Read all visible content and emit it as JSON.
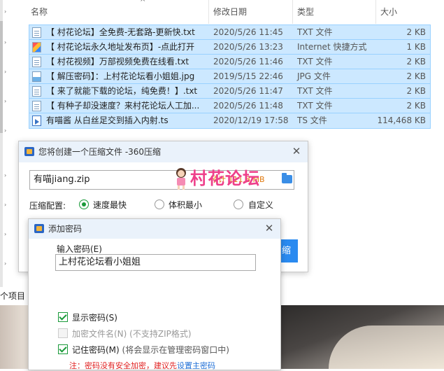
{
  "explorer": {
    "columns": {
      "name": "名称",
      "date": "修改日期",
      "type": "类型",
      "size": "大小"
    },
    "files": [
      {
        "name": "【 村花论坛】全免费-无套路-更新快.txt",
        "date": "2020/5/26 11:45",
        "type": "TXT 文件",
        "size": "2 KB",
        "icon": "text-file-icon",
        "selected": true
      },
      {
        "name": "【 村花论坛永久地址发布页】-点此打开",
        "date": "2020/5/26 13:23",
        "type": "Internet 快捷方式",
        "size": "1 KB",
        "icon": "internet-shortcut-icon",
        "selected": true
      },
      {
        "name": "【 村花视频】万部视频免费在线看.txt",
        "date": "2020/5/26 11:46",
        "type": "TXT 文件",
        "size": "2 KB",
        "icon": "text-file-icon",
        "selected": true
      },
      {
        "name": "【 解压密码】：上村花论坛看小姐姐.jpg",
        "date": "2019/5/15 22:46",
        "type": "JPG 文件",
        "size": "2 KB",
        "icon": "image-file-icon",
        "selected": true
      },
      {
        "name": "【 来了就能下载的论坛，纯免费！】.txt",
        "date": "2020/5/26 11:47",
        "type": "TXT 文件",
        "size": "2 KB",
        "icon": "text-file-icon",
        "selected": true
      },
      {
        "name": "【 有种子却没速度？来村花论坛人工加...",
        "date": "2020/5/26 11:48",
        "type": "TXT 文件",
        "size": "2 KB",
        "icon": "text-file-icon",
        "selected": true
      },
      {
        "name": "有喵酱 从白丝足交到插入内射.ts",
        "date": "2020/12/19 17:58",
        "type": "TS 文件",
        "size": "114,468 KB",
        "icon": "video-file-icon",
        "selected": true
      }
    ],
    "status_count": "个项目"
  },
  "compress_dialog": {
    "title": "您将创建一个压缩文件 -360压缩",
    "file_name": "有喵jiang.zip",
    "size_hint": "预计 111.8 MB",
    "option_label": "压缩配置:",
    "options": [
      "速度最快",
      "体积最小",
      "自定义"
    ],
    "selected_option": "速度最快",
    "start_button": "缩"
  },
  "password_dialog": {
    "title": "添加密码",
    "password_label": "输入密码(E)",
    "password_value": "上村花论坛看小姐姐",
    "show_password": {
      "label": "显示密码(S)",
      "checked": true
    },
    "encrypt_filenames": {
      "label": "加密文件名(N)",
      "note": "(不支持ZIP格式)",
      "checked": false,
      "disabled": true
    },
    "remember_password": {
      "label": "记住密码(M)",
      "note": "(将会显示在管理密码窗口中)",
      "checked": true
    },
    "warning": "注：密码没有安全加密，建议先",
    "warning_link": "设置主密码"
  },
  "watermark": {
    "text": "村花论坛"
  },
  "colors": {
    "accent": "#2a8af0",
    "selection": "#cce8ff",
    "check": "#1a9a3a",
    "watermark": "#ee3f8a",
    "warning": "#e02020"
  }
}
